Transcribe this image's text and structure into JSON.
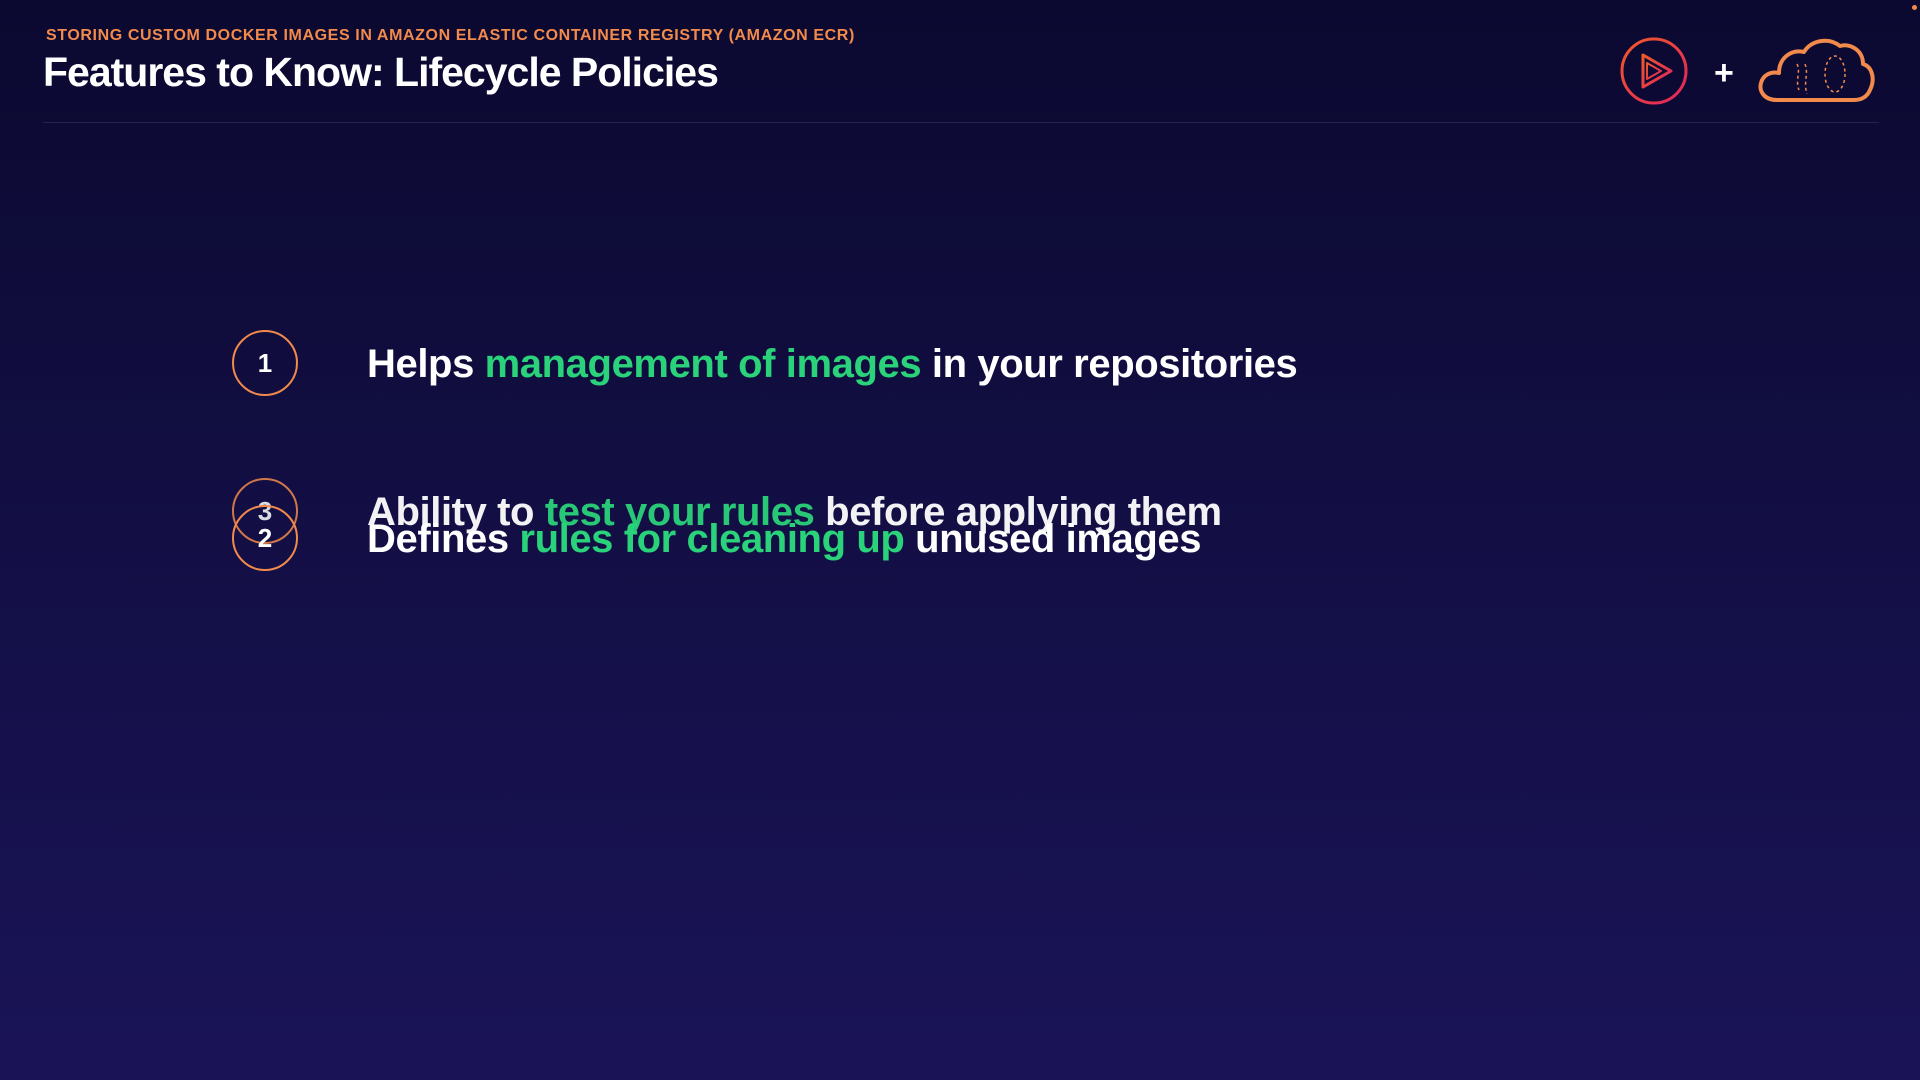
{
  "header": {
    "eyebrow": "STORING CUSTOM DOCKER IMAGES IN AMAZON ELASTIC CONTAINER REGISTRY (AMAZON ECR)",
    "title": "Features to Know: Lifecycle Policies",
    "plus": "+"
  },
  "icons": {
    "play_logo": "play-logo-icon",
    "cloud_logo": "cloud-logo-icon"
  },
  "colors": {
    "accent_orange": "#f28a4b",
    "highlight_green": "#2ad27a",
    "play_red": "#e0245e"
  },
  "items": [
    {
      "number": "1",
      "before": "Helps ",
      "highlight": "management of images",
      "after": " in your repositories"
    },
    {
      "number": "2",
      "before": "Defines ",
      "highlight": "rules for cleaning up",
      "after": " unused images"
    },
    {
      "number": "3",
      "before": "Ability to ",
      "highlight": "test your rules",
      "after": " before applying them"
    }
  ]
}
